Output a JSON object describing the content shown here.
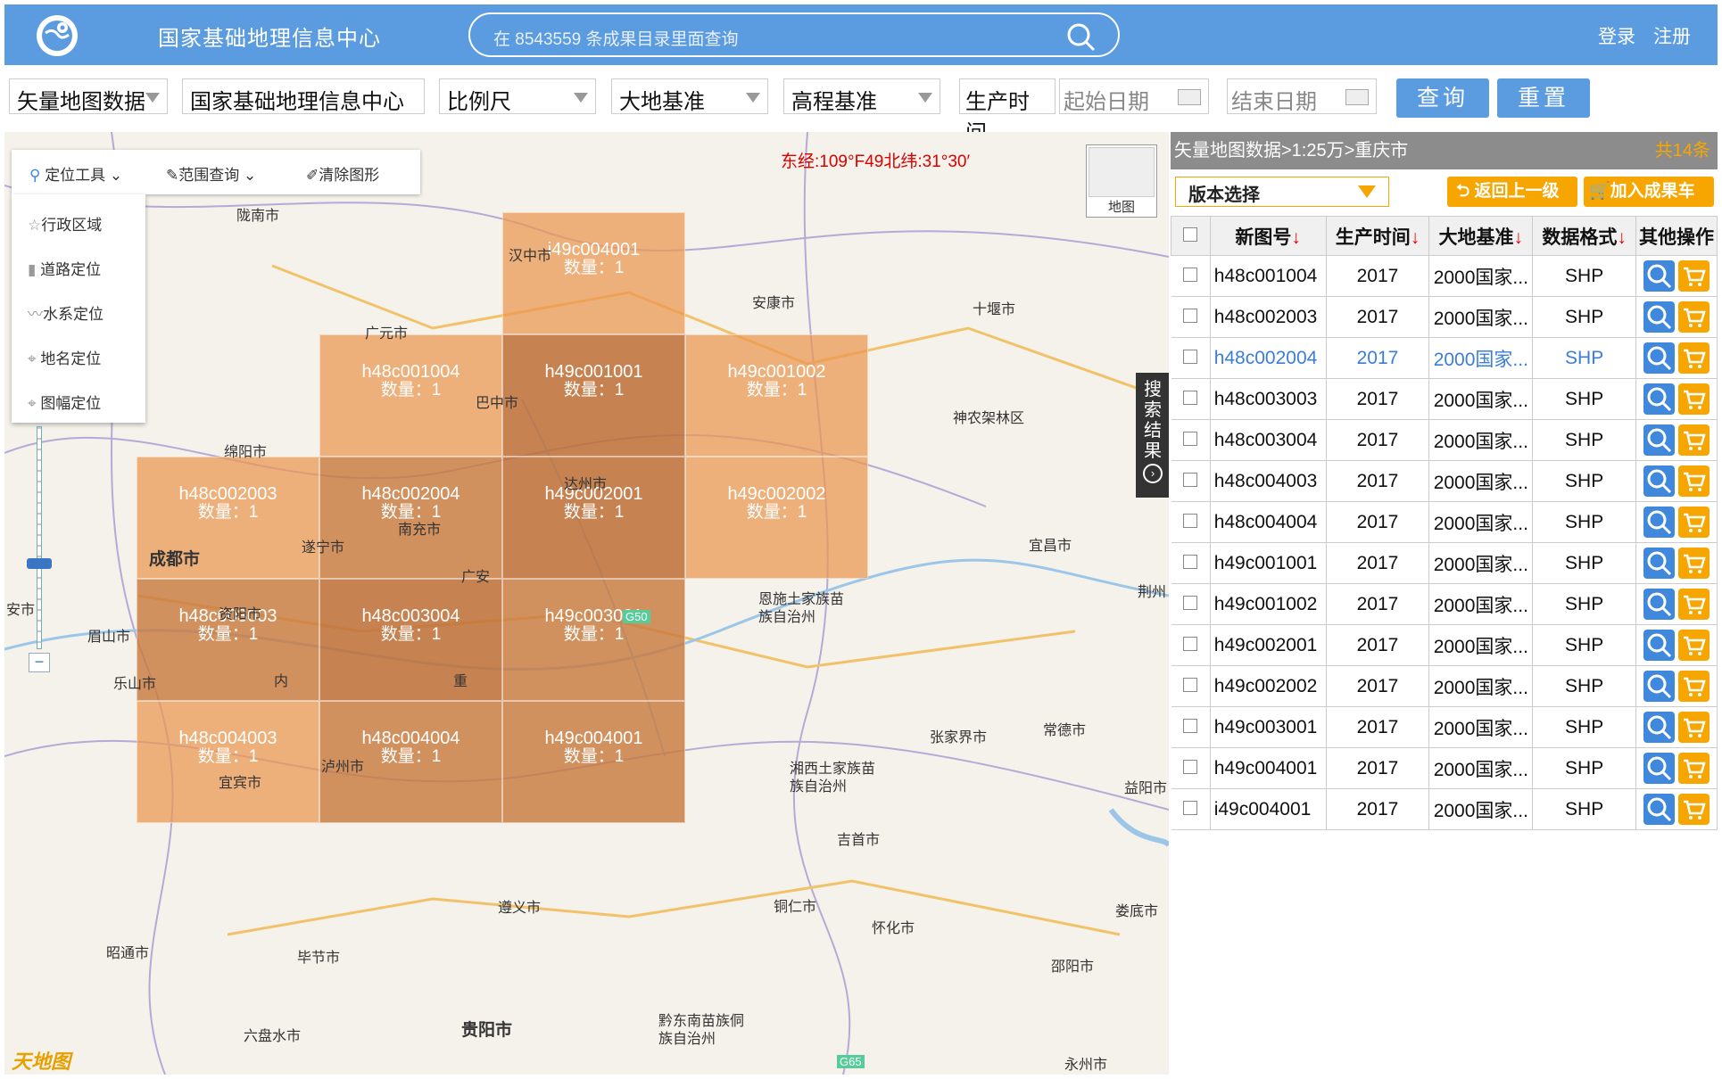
{
  "header": {
    "site_title": "国家基础地理信息中心",
    "search_placeholder": "在 8543559 条成果目录里面查询",
    "login": "登录",
    "register": "注册"
  },
  "filters": {
    "data_type": "矢量地图数据",
    "org": "国家基础地理信息中心",
    "scale": "比例尺",
    "datum": "大地基准",
    "elevation": "高程基准",
    "time_label": "生产时间",
    "start_date": "起始日期",
    "end_date": "结束日期",
    "query_btn": "查询",
    "reset_btn": "重置"
  },
  "map": {
    "tools": {
      "locate": "定位工具",
      "range": "范围查询",
      "clear": "清除图形"
    },
    "locate_menu": [
      "行政区域",
      "道路定位",
      "水系定位",
      "地名定位",
      "图幅定位"
    ],
    "coord": "东经:109°",
    "coord_overlap": "F49北纬:31°30′",
    "maptype_label": "地图",
    "side_tab": [
      "搜",
      "索",
      "结",
      "果"
    ],
    "logo": "天地图",
    "tile_count_label": "数量：1",
    "tiles": [
      {
        "name": "i49c004001",
        "count": "数量：1"
      },
      {
        "name": "h48c001004",
        "count": "数量：1"
      },
      {
        "name": "h49c001001",
        "count": "数量：1"
      },
      {
        "name": "h49c001002",
        "count": "数量：1"
      },
      {
        "name": "h48c002003",
        "count": "数量：1"
      },
      {
        "name": "h48c002004",
        "count": "数量：1"
      },
      {
        "name": "h49c002001",
        "count": "数量：1"
      },
      {
        "name": "h49c002002",
        "count": "数量：1"
      },
      {
        "name": "h48c003003",
        "count": "数量：1"
      },
      {
        "name": "h48c003004",
        "count": "数量：1"
      },
      {
        "name": "h49c003001",
        "count": "数量：1"
      },
      {
        "name": "h48c004003",
        "count": "数量：1"
      },
      {
        "name": "h48c004004",
        "count": "数量：1"
      },
      {
        "name": "h49c004001",
        "count": "数量：1"
      }
    ],
    "cities": [
      "陇南市",
      "汉中市",
      "安康市",
      "十堰市",
      "广元市",
      "巴中市",
      "神农架林区",
      "绵阳市",
      "达州市",
      "南充市",
      "遂宁市",
      "广安",
      "宜昌市",
      "成都市",
      "资阳市",
      "恩施土家族苗族自治州",
      "荆州",
      "眉山市",
      "乐山市",
      "内",
      "重",
      "张家界市",
      "常德市",
      "泸州市",
      "宜宾市",
      "湘西土家族苗族自治州",
      "益阳市",
      "吉首市",
      "遵义市",
      "铜仁市",
      "娄底市",
      "怀化市",
      "昭通市",
      "毕节市",
      "邵阳市",
      "六盘水市",
      "贵阳市",
      "黔东南苗族侗族自治州",
      "永州市",
      "安市",
      "G50",
      "G65"
    ]
  },
  "panel": {
    "breadcrumb": "矢量地图数据>1:25万>重庆市",
    "total": "共14条",
    "version": "版本选择",
    "back_btn": "返回上一级",
    "cart_btn": "加入成果车",
    "columns": [
      "新图号",
      "生产时间",
      "大地基准",
      "数据格式",
      "其他操作"
    ],
    "rows": [
      {
        "id": "h48c001004",
        "year": "2017",
        "datum": "2000国家...",
        "fmt": "SHP"
      },
      {
        "id": "h48c002003",
        "year": "2017",
        "datum": "2000国家...",
        "fmt": "SHP"
      },
      {
        "id": "h48c002004",
        "year": "2017",
        "datum": "2000国家...",
        "fmt": "SHP"
      },
      {
        "id": "h48c003003",
        "year": "2017",
        "datum": "2000国家...",
        "fmt": "SHP"
      },
      {
        "id": "h48c003004",
        "year": "2017",
        "datum": "2000国家...",
        "fmt": "SHP"
      },
      {
        "id": "h48c004003",
        "year": "2017",
        "datum": "2000国家...",
        "fmt": "SHP"
      },
      {
        "id": "h48c004004",
        "year": "2017",
        "datum": "2000国家...",
        "fmt": "SHP"
      },
      {
        "id": "h49c001001",
        "year": "2017",
        "datum": "2000国家...",
        "fmt": "SHP"
      },
      {
        "id": "h49c001002",
        "year": "2017",
        "datum": "2000国家...",
        "fmt": "SHP"
      },
      {
        "id": "h49c002001",
        "year": "2017",
        "datum": "2000国家...",
        "fmt": "SHP"
      },
      {
        "id": "h49c002002",
        "year": "2017",
        "datum": "2000国家...",
        "fmt": "SHP"
      },
      {
        "id": "h49c003001",
        "year": "2017",
        "datum": "2000国家...",
        "fmt": "SHP"
      },
      {
        "id": "h49c004001",
        "year": "2017",
        "datum": "2000国家...",
        "fmt": "SHP"
      },
      {
        "id": "i49c004001",
        "year": "2017",
        "datum": "2000国家...",
        "fmt": "SHP"
      }
    ],
    "highlight_row": "h48c002004"
  }
}
